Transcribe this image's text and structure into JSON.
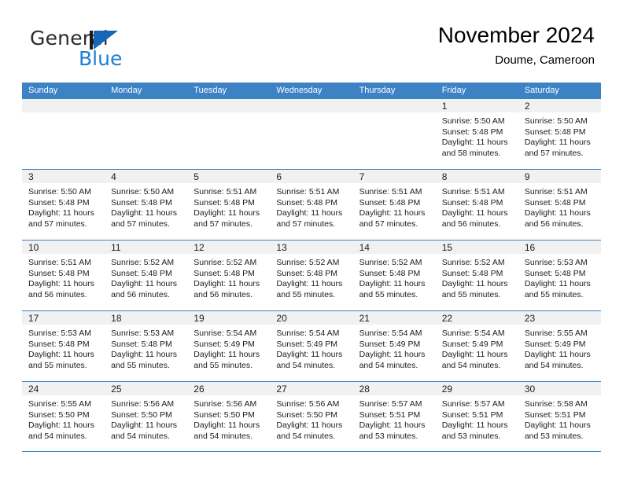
{
  "brand": {
    "name_part1": "General",
    "name_part2": "Blue",
    "flag_icon": "flag-triangle-icon",
    "accent_color": "#1b7fd4"
  },
  "header": {
    "month_title": "November 2024",
    "location": "Doume, Cameroon"
  },
  "calendar": {
    "header_bg": "#3c82c4",
    "weekdays": [
      "Sunday",
      "Monday",
      "Tuesday",
      "Wednesday",
      "Thursday",
      "Friday",
      "Saturday"
    ],
    "weeks": [
      [
        {
          "day": "",
          "sunrise": "",
          "sunset": "",
          "daylight1": "",
          "daylight2": ""
        },
        {
          "day": "",
          "sunrise": "",
          "sunset": "",
          "daylight1": "",
          "daylight2": ""
        },
        {
          "day": "",
          "sunrise": "",
          "sunset": "",
          "daylight1": "",
          "daylight2": ""
        },
        {
          "day": "",
          "sunrise": "",
          "sunset": "",
          "daylight1": "",
          "daylight2": ""
        },
        {
          "day": "",
          "sunrise": "",
          "sunset": "",
          "daylight1": "",
          "daylight2": ""
        },
        {
          "day": "1",
          "sunrise": "Sunrise: 5:50 AM",
          "sunset": "Sunset: 5:48 PM",
          "daylight1": "Daylight: 11 hours",
          "daylight2": "and 58 minutes."
        },
        {
          "day": "2",
          "sunrise": "Sunrise: 5:50 AM",
          "sunset": "Sunset: 5:48 PM",
          "daylight1": "Daylight: 11 hours",
          "daylight2": "and 57 minutes."
        }
      ],
      [
        {
          "day": "3",
          "sunrise": "Sunrise: 5:50 AM",
          "sunset": "Sunset: 5:48 PM",
          "daylight1": "Daylight: 11 hours",
          "daylight2": "and 57 minutes."
        },
        {
          "day": "4",
          "sunrise": "Sunrise: 5:50 AM",
          "sunset": "Sunset: 5:48 PM",
          "daylight1": "Daylight: 11 hours",
          "daylight2": "and 57 minutes."
        },
        {
          "day": "5",
          "sunrise": "Sunrise: 5:51 AM",
          "sunset": "Sunset: 5:48 PM",
          "daylight1": "Daylight: 11 hours",
          "daylight2": "and 57 minutes."
        },
        {
          "day": "6",
          "sunrise": "Sunrise: 5:51 AM",
          "sunset": "Sunset: 5:48 PM",
          "daylight1": "Daylight: 11 hours",
          "daylight2": "and 57 minutes."
        },
        {
          "day": "7",
          "sunrise": "Sunrise: 5:51 AM",
          "sunset": "Sunset: 5:48 PM",
          "daylight1": "Daylight: 11 hours",
          "daylight2": "and 57 minutes."
        },
        {
          "day": "8",
          "sunrise": "Sunrise: 5:51 AM",
          "sunset": "Sunset: 5:48 PM",
          "daylight1": "Daylight: 11 hours",
          "daylight2": "and 56 minutes."
        },
        {
          "day": "9",
          "sunrise": "Sunrise: 5:51 AM",
          "sunset": "Sunset: 5:48 PM",
          "daylight1": "Daylight: 11 hours",
          "daylight2": "and 56 minutes."
        }
      ],
      [
        {
          "day": "10",
          "sunrise": "Sunrise: 5:51 AM",
          "sunset": "Sunset: 5:48 PM",
          "daylight1": "Daylight: 11 hours",
          "daylight2": "and 56 minutes."
        },
        {
          "day": "11",
          "sunrise": "Sunrise: 5:52 AM",
          "sunset": "Sunset: 5:48 PM",
          "daylight1": "Daylight: 11 hours",
          "daylight2": "and 56 minutes."
        },
        {
          "day": "12",
          "sunrise": "Sunrise: 5:52 AM",
          "sunset": "Sunset: 5:48 PM",
          "daylight1": "Daylight: 11 hours",
          "daylight2": "and 56 minutes."
        },
        {
          "day": "13",
          "sunrise": "Sunrise: 5:52 AM",
          "sunset": "Sunset: 5:48 PM",
          "daylight1": "Daylight: 11 hours",
          "daylight2": "and 55 minutes."
        },
        {
          "day": "14",
          "sunrise": "Sunrise: 5:52 AM",
          "sunset": "Sunset: 5:48 PM",
          "daylight1": "Daylight: 11 hours",
          "daylight2": "and 55 minutes."
        },
        {
          "day": "15",
          "sunrise": "Sunrise: 5:52 AM",
          "sunset": "Sunset: 5:48 PM",
          "daylight1": "Daylight: 11 hours",
          "daylight2": "and 55 minutes."
        },
        {
          "day": "16",
          "sunrise": "Sunrise: 5:53 AM",
          "sunset": "Sunset: 5:48 PM",
          "daylight1": "Daylight: 11 hours",
          "daylight2": "and 55 minutes."
        }
      ],
      [
        {
          "day": "17",
          "sunrise": "Sunrise: 5:53 AM",
          "sunset": "Sunset: 5:48 PM",
          "daylight1": "Daylight: 11 hours",
          "daylight2": "and 55 minutes."
        },
        {
          "day": "18",
          "sunrise": "Sunrise: 5:53 AM",
          "sunset": "Sunset: 5:48 PM",
          "daylight1": "Daylight: 11 hours",
          "daylight2": "and 55 minutes."
        },
        {
          "day": "19",
          "sunrise": "Sunrise: 5:54 AM",
          "sunset": "Sunset: 5:49 PM",
          "daylight1": "Daylight: 11 hours",
          "daylight2": "and 55 minutes."
        },
        {
          "day": "20",
          "sunrise": "Sunrise: 5:54 AM",
          "sunset": "Sunset: 5:49 PM",
          "daylight1": "Daylight: 11 hours",
          "daylight2": "and 54 minutes."
        },
        {
          "day": "21",
          "sunrise": "Sunrise: 5:54 AM",
          "sunset": "Sunset: 5:49 PM",
          "daylight1": "Daylight: 11 hours",
          "daylight2": "and 54 minutes."
        },
        {
          "day": "22",
          "sunrise": "Sunrise: 5:54 AM",
          "sunset": "Sunset: 5:49 PM",
          "daylight1": "Daylight: 11 hours",
          "daylight2": "and 54 minutes."
        },
        {
          "day": "23",
          "sunrise": "Sunrise: 5:55 AM",
          "sunset": "Sunset: 5:49 PM",
          "daylight1": "Daylight: 11 hours",
          "daylight2": "and 54 minutes."
        }
      ],
      [
        {
          "day": "24",
          "sunrise": "Sunrise: 5:55 AM",
          "sunset": "Sunset: 5:50 PM",
          "daylight1": "Daylight: 11 hours",
          "daylight2": "and 54 minutes."
        },
        {
          "day": "25",
          "sunrise": "Sunrise: 5:56 AM",
          "sunset": "Sunset: 5:50 PM",
          "daylight1": "Daylight: 11 hours",
          "daylight2": "and 54 minutes."
        },
        {
          "day": "26",
          "sunrise": "Sunrise: 5:56 AM",
          "sunset": "Sunset: 5:50 PM",
          "daylight1": "Daylight: 11 hours",
          "daylight2": "and 54 minutes."
        },
        {
          "day": "27",
          "sunrise": "Sunrise: 5:56 AM",
          "sunset": "Sunset: 5:50 PM",
          "daylight1": "Daylight: 11 hours",
          "daylight2": "and 54 minutes."
        },
        {
          "day": "28",
          "sunrise": "Sunrise: 5:57 AM",
          "sunset": "Sunset: 5:51 PM",
          "daylight1": "Daylight: 11 hours",
          "daylight2": "and 53 minutes."
        },
        {
          "day": "29",
          "sunrise": "Sunrise: 5:57 AM",
          "sunset": "Sunset: 5:51 PM",
          "daylight1": "Daylight: 11 hours",
          "daylight2": "and 53 minutes."
        },
        {
          "day": "30",
          "sunrise": "Sunrise: 5:58 AM",
          "sunset": "Sunset: 5:51 PM",
          "daylight1": "Daylight: 11 hours",
          "daylight2": "and 53 minutes."
        }
      ]
    ]
  }
}
